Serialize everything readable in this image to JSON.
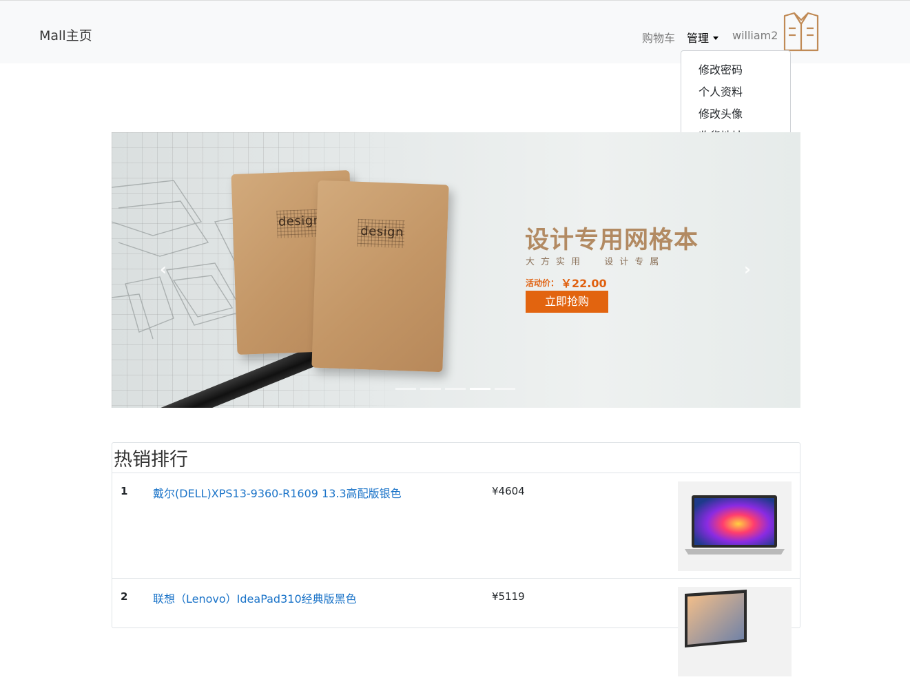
{
  "navbar": {
    "brand": "Mall主页",
    "cart": "购物车",
    "manage": "管理",
    "username": "william2"
  },
  "dropdown": {
    "items": [
      "修改密码",
      "个人资料",
      "修改头像",
      "收货地址"
    ]
  },
  "carousel": {
    "notebook_logo": "design",
    "title": "设计专用网格本",
    "subtitle": "大方实用  设计专属",
    "price_label": "活动价：",
    "price": "￥22.00",
    "button": "立即抢购",
    "slide_count": 5,
    "active_slide": 4
  },
  "hot": {
    "title": "热销排行",
    "rows": [
      {
        "rank": "1",
        "name": "戴尔(DELL)XPS13-9360-R1609 13.3高配版银色",
        "price": "¥4604"
      },
      {
        "rank": "2",
        "name": "联想（Lenovo）IdeaPad310经典版黑色",
        "price": "¥5119"
      }
    ]
  },
  "colors": {
    "accent_orange": "#e2640f",
    "link_blue": "#1a73c8",
    "promo_brown": "#b28a62"
  }
}
